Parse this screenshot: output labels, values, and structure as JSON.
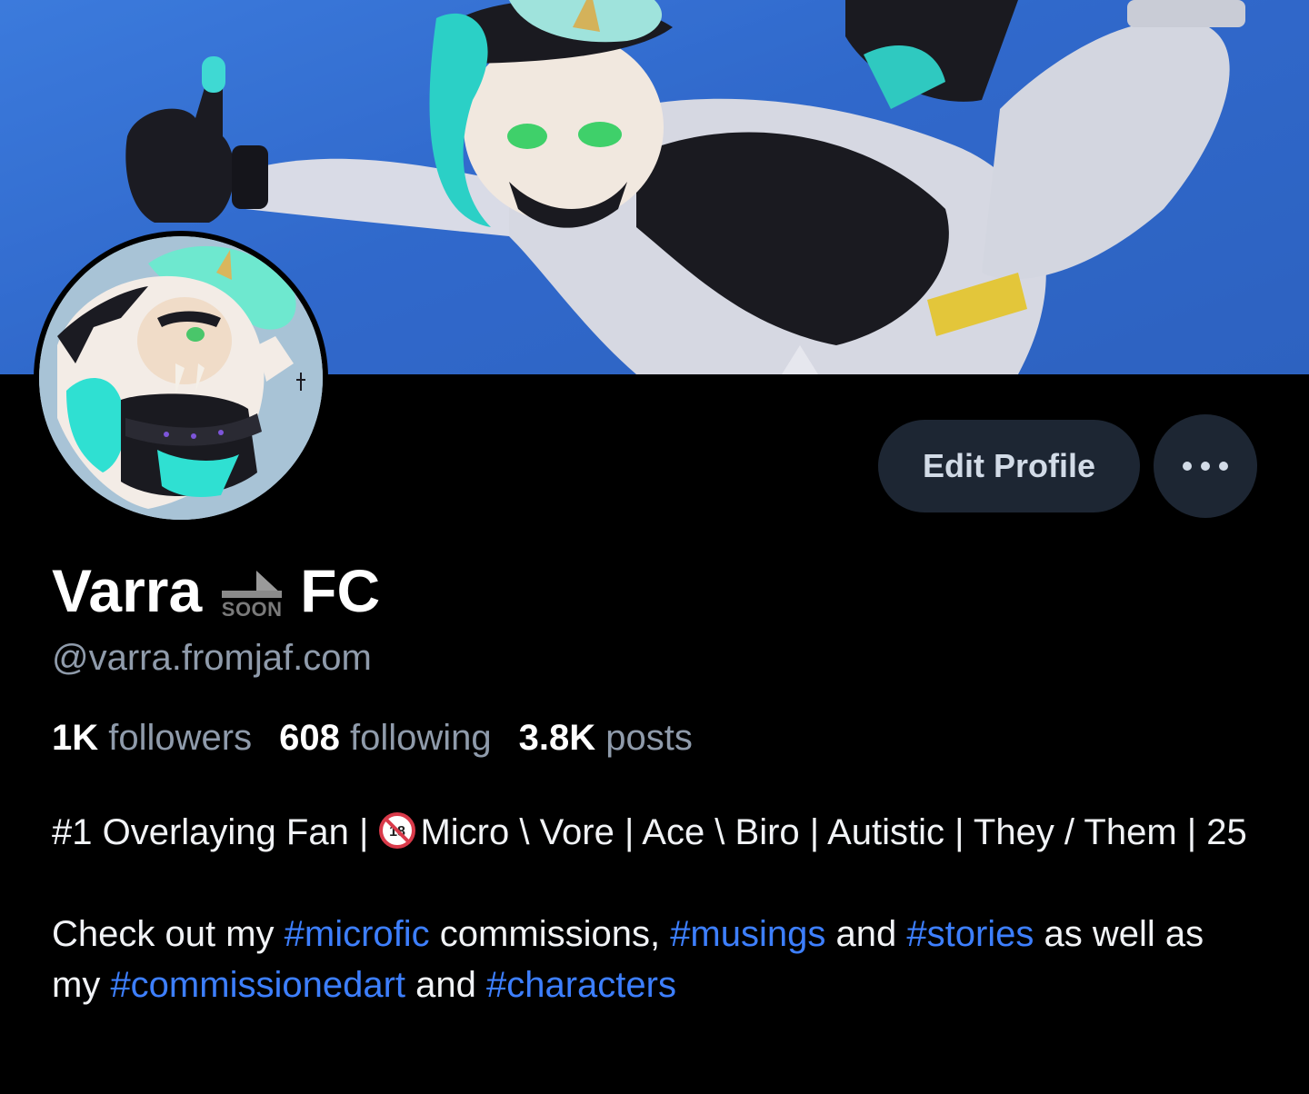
{
  "banner": {
    "alt": "banner-image"
  },
  "profile": {
    "name_part1": "Varra",
    "name_emoji_text": "SOON",
    "name_part2": "FC",
    "handle": "@varra.fromjaf.com"
  },
  "actions": {
    "edit_label": "Edit Profile",
    "more_icon": "ellipsis-icon"
  },
  "stats": [
    {
      "value": "1K",
      "label": "followers"
    },
    {
      "value": "608",
      "label": "following"
    },
    {
      "value": "3.8K",
      "label": "posts"
    }
  ],
  "bio": {
    "line1_a": "#1 Overlaying Fan | ",
    "line1_b": "Micro \\ Vore | Ace \\ Biro | Autistic | They / Them | 25",
    "p2_1": "Check out my ",
    "p2_tag1": "#microfic",
    "p2_2": " commissions, ",
    "p2_tag2": "#musings",
    "p2_3": " and ",
    "p2_tag3": "#stories",
    "p2_4": " as well as my ",
    "p2_tag4": "#commissionedart",
    "p2_5": " and ",
    "p2_tag5": "#characters"
  },
  "colors": {
    "background": "#000000",
    "button_bg": "#1d2633",
    "muted_text": "#8f9bab",
    "link": "#3d7fff"
  }
}
